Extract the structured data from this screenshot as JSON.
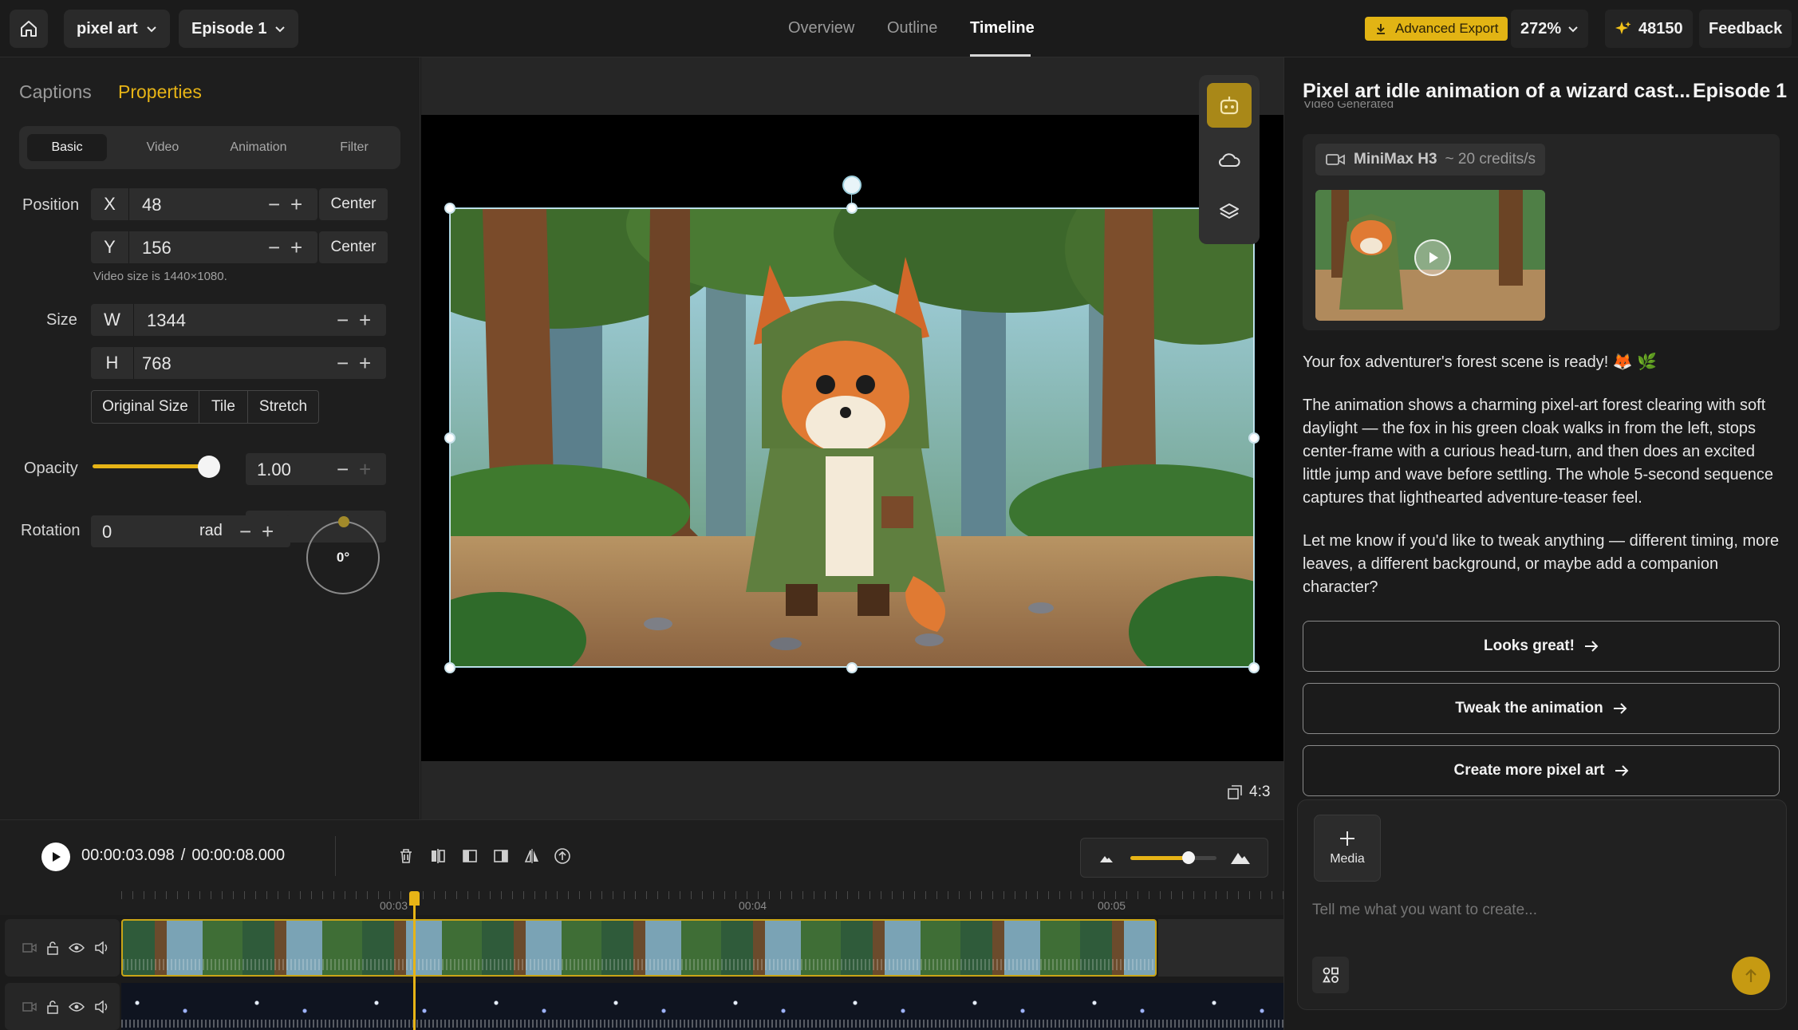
{
  "topbar": {
    "project_name": "pixel art",
    "episode": "Episode 1",
    "tabs": [
      {
        "label": "Overview",
        "active": false
      },
      {
        "label": "Outline",
        "active": false
      },
      {
        "label": "Timeline",
        "active": true
      }
    ],
    "export_label": "Advanced Export",
    "zoom": "272%",
    "credits": "48150",
    "feedback_label": "Feedback",
    "accent_color": "#e2b414"
  },
  "left_panel": {
    "tabs": [
      {
        "label": "Captions",
        "active": false
      },
      {
        "label": "Properties",
        "active": true
      }
    ],
    "subtabs": [
      {
        "label": "Basic",
        "active": true
      },
      {
        "label": "Video",
        "active": false
      },
      {
        "label": "Animation",
        "active": false
      },
      {
        "label": "Filter",
        "active": false
      }
    ],
    "position": {
      "label": "Position",
      "x_axis": "X",
      "x": "48",
      "y_axis": "Y",
      "y": "156",
      "center_label": "Center",
      "hint": "Video size is 1440×1080."
    },
    "size": {
      "label": "Size",
      "w_axis": "W",
      "w": "1344",
      "h_axis": "H",
      "h": "768",
      "modes": [
        "Original Size",
        "Tile",
        "Stretch"
      ]
    },
    "opacity": {
      "label": "Opacity",
      "value": "1.00",
      "level": 1.0
    },
    "rotation": {
      "label": "Rotation",
      "value": "0",
      "unit": "rad",
      "dial": "0°"
    }
  },
  "canvas": {
    "aspect_ratio": "4:3",
    "tools": [
      "robot-icon",
      "cloud-icon",
      "layers-icon"
    ]
  },
  "right_panel": {
    "title": "Pixel art idle animation of a wizard cast...",
    "episode": "Episode 1",
    "subtitle": "Video Generated",
    "model": "MiniMax H3",
    "rate": "~ 20 credits/s",
    "msg_ready": "Your fox adventurer's forest scene is ready! 🦊 🌿",
    "msg_desc": "The animation shows a charming pixel-art forest clearing with soft daylight — the fox in his green cloak walks in from the left, stops center-frame with a curious head-turn, and then does an excited little jump and wave before settling. The whole 5-second sequence captures that lighthearted adventure-teaser feel.",
    "msg_ask": "Let me know if you'd like to tweak anything — different timing, more leaves, a different background, or maybe add a companion character?",
    "suggestions": [
      "Looks great!",
      "Tweak the animation",
      "Create more pixel art"
    ],
    "media_label": "Media",
    "input_placeholder": "Tell me what you want to create..."
  },
  "timeline": {
    "current_time": "00:00:03.098",
    "separator": "/",
    "total_time": "00:00:08.000",
    "ruler_labels": [
      "00:03",
      "00:04",
      "00:05"
    ],
    "zoom_level": 0.68,
    "playhead_fraction": 0.252
  }
}
